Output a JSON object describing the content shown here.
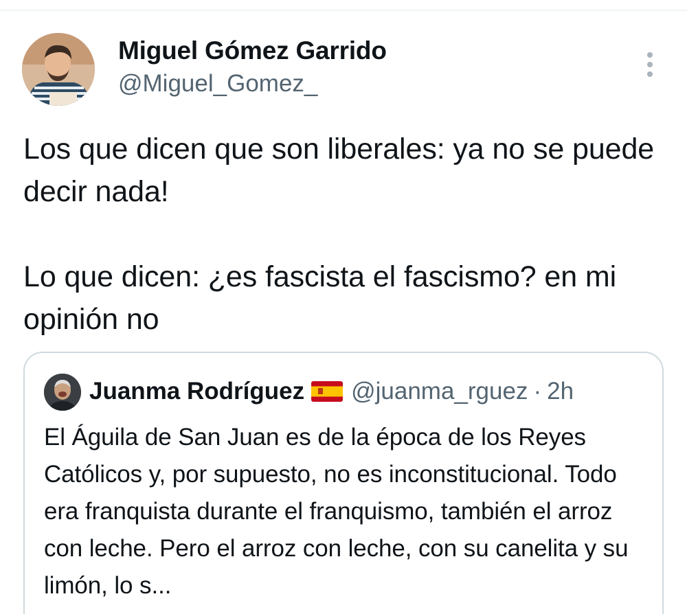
{
  "tweet": {
    "author_name": "Miguel Gómez Garrido",
    "author_handle": "@Miguel_Gomez_",
    "more_icon": "more-vertical-icon",
    "text": "Los que dicen que son liberales: ya no se puede decir nada!\n\nLo que dicen: ¿es fascista el fascismo? en mi opinión no"
  },
  "quoted_tweet": {
    "author_name": "Juanma Rodríguez",
    "flag_icon": "spain-flag-icon",
    "author_handle": "@juanma_rguez",
    "separator": "·",
    "time": "2h",
    "text": "El Águila de San Juan es de la época de los Reyes Católicos y, por supuesto, no es inconstitucional. Todo era franquista durante el franquismo, también el arroz con leche. Pero el arroz con leche, con su canelita y su limón, lo s..."
  },
  "colors": {
    "text_primary": "#0f1419",
    "text_secondary": "#536471",
    "border": "#cfd9de",
    "flag_red": "#c60b1e",
    "flag_yellow": "#ffc400"
  }
}
